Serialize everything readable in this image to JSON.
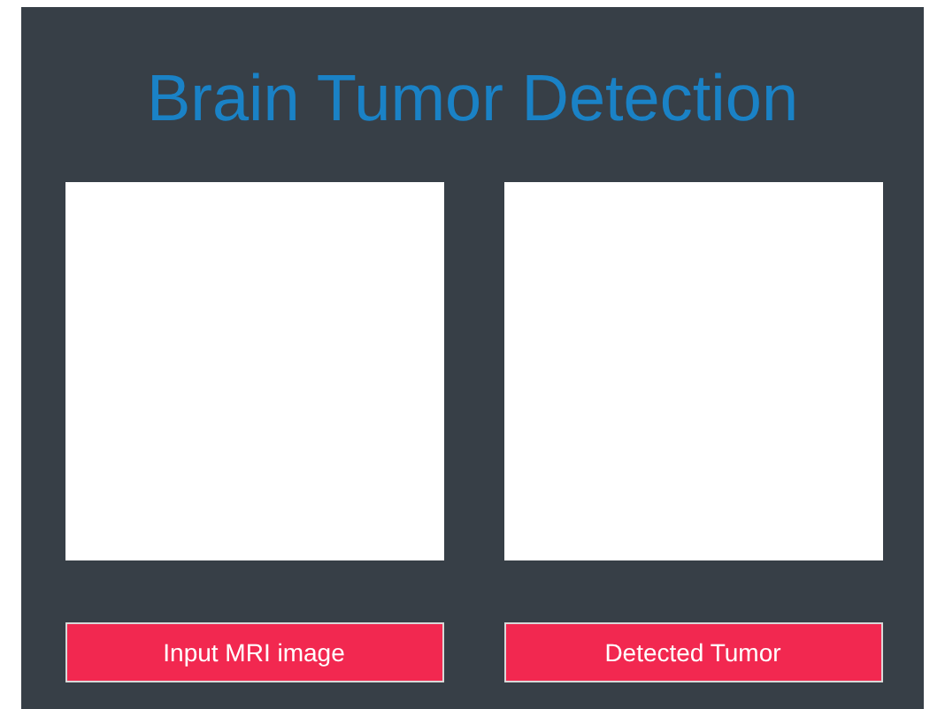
{
  "title": "Brain Tumor Detection",
  "panels": [
    {
      "button": "Input MRI image"
    },
    {
      "button": "Detected Tumor"
    }
  ]
}
